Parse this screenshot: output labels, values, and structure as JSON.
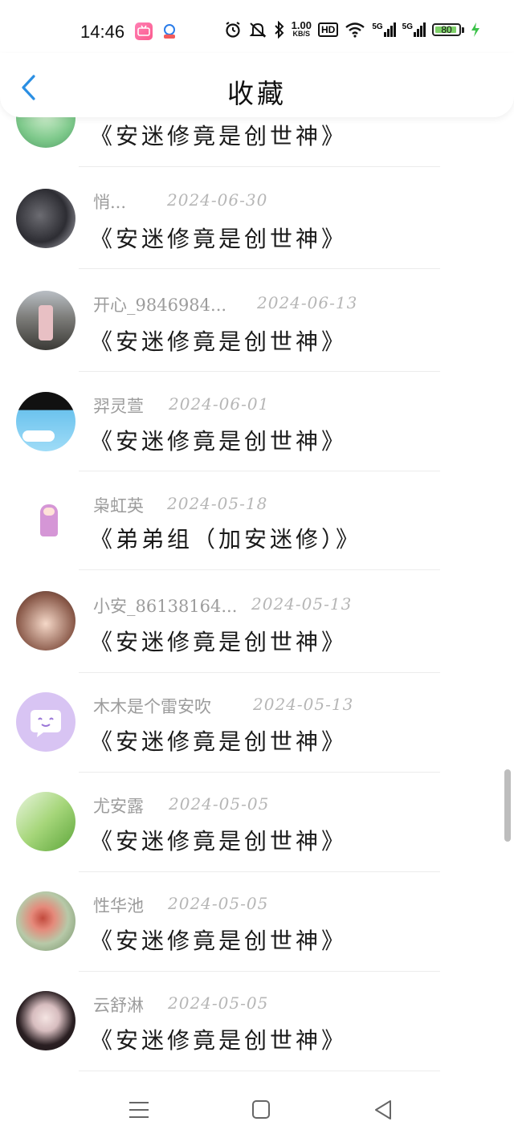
{
  "status_bar": {
    "time": "14:46",
    "network_speed_value": "1.00",
    "network_speed_unit": "KB/S",
    "hd_label": "HD",
    "signal1_label": "5G",
    "signal2_label": "5G",
    "battery": "80",
    "icons": [
      "bilibili-app-icon",
      "app-notification-icon",
      "alarm-icon",
      "mute-icon",
      "bluetooth-icon",
      "hd-voice-icon",
      "wifi-icon",
      "signal-icon",
      "signal-icon",
      "battery-icon",
      "charging-icon"
    ]
  },
  "header": {
    "title": "收藏",
    "back_icon": "chevron-left-icon",
    "accent_color": "#2b8fe3"
  },
  "items": [
    {
      "author": "",
      "date": "",
      "title": "《安迷修竟是创世神》",
      "avatar": "green-anime-avatar"
    },
    {
      "author": "悄...",
      "date": "2024-06-30",
      "title": "《安迷修竟是创世神》",
      "avatar": "dark-photo-avatar"
    },
    {
      "author": "开心_9846984...",
      "date": "2024-06-13",
      "title": "《安迷修竟是创世神》",
      "avatar": "street-photo-avatar"
    },
    {
      "author": "羿灵萱",
      "date": "2024-06-01",
      "title": "《安迷修竟是创世神》",
      "avatar": "sky-cartoon-avatar"
    },
    {
      "author": "枭虹英",
      "date": "2024-05-18",
      "title": "《弟弟组（加安迷修）》",
      "avatar": "pink-doll-avatar"
    },
    {
      "author": "小安_86138164...",
      "date": "2024-05-13",
      "title": "《安迷修竟是创世神》",
      "avatar": "anime-girl-avatar"
    },
    {
      "author": "木木是个雷安吹",
      "date": "2024-05-13",
      "title": "《安迷修竟是创世神》",
      "avatar": "purple-chat-avatar"
    },
    {
      "author": "尤安露",
      "date": "2024-05-05",
      "title": "《安迷修竟是创世神》",
      "avatar": "green-leaf-avatar"
    },
    {
      "author": "性华池",
      "date": "2024-05-05",
      "title": "《安迷修竟是创世神》",
      "avatar": "flower-avatar"
    },
    {
      "author": "云舒淋",
      "date": "2024-05-05",
      "title": "《安迷修竟是创世神》",
      "avatar": "girl-portrait-avatar"
    }
  ],
  "nav_bar": {
    "icons": [
      "menu-icon",
      "home-icon",
      "back-triangle-icon"
    ]
  }
}
